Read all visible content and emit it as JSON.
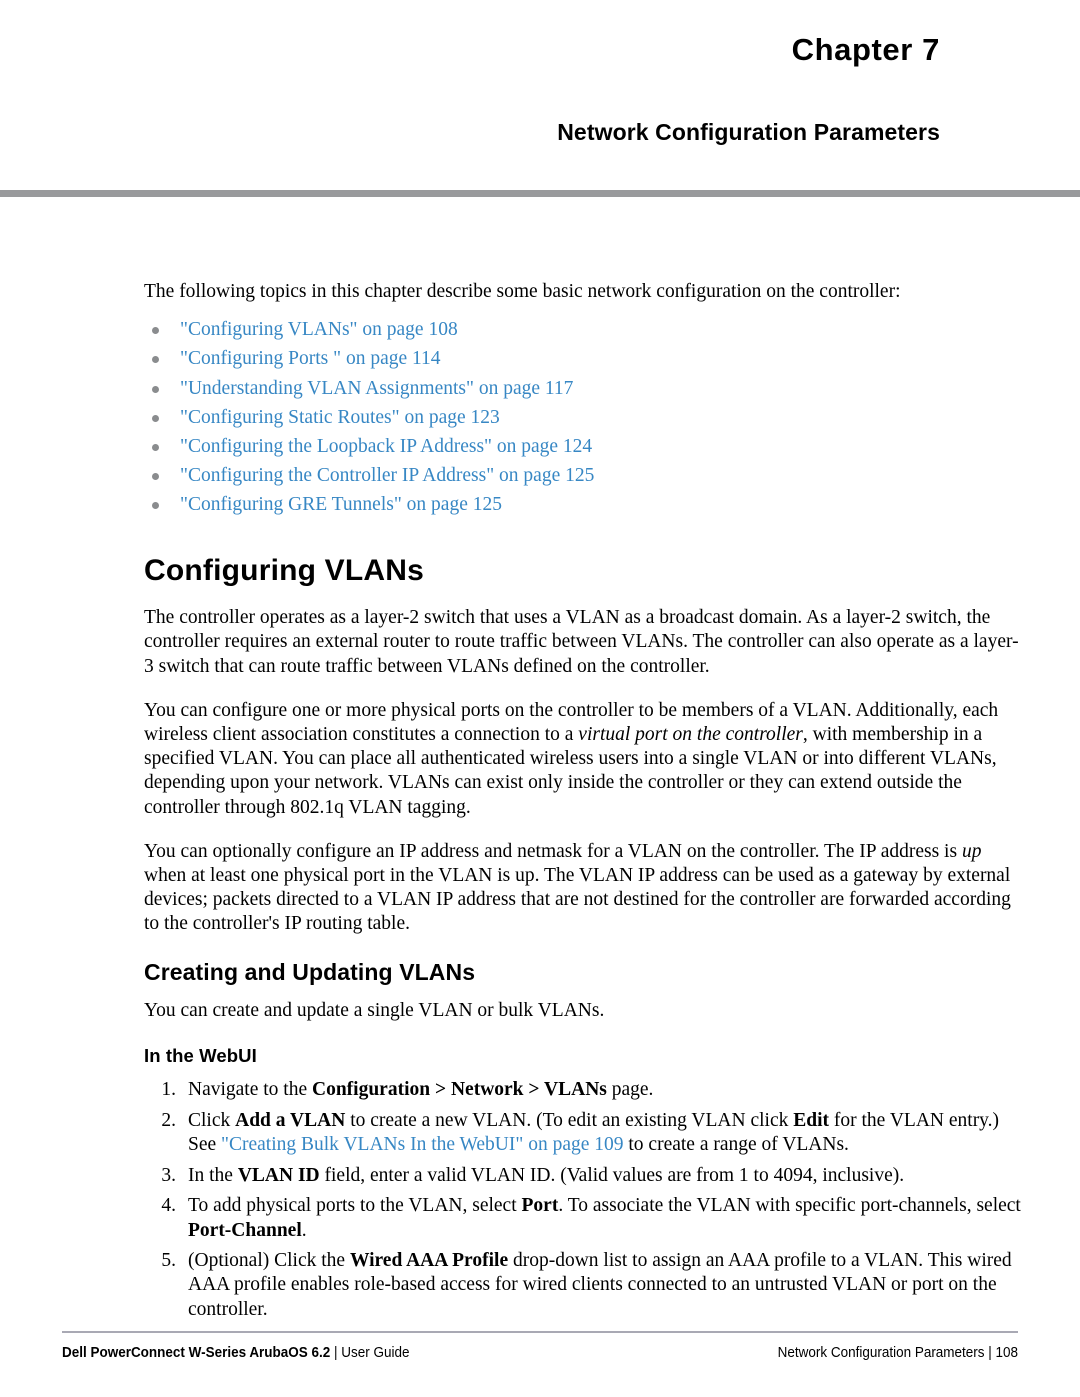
{
  "header": {
    "chapter_number": "Chapter 7",
    "chapter_title": "Network Configuration Parameters",
    "rule_color": "#999a9c"
  },
  "colors": {
    "link": "#3787c4",
    "bullet": "#8a8c8e",
    "header_rule": "#999a9c",
    "footer_rule": "#a9a9b4",
    "text": "#000000"
  },
  "intro": {
    "text": "The following topics in this chapter describe some basic network configuration on the controller:"
  },
  "topics": [
    {
      "label": "\"Configuring VLANs\" on page 108"
    },
    {
      "label": "\"Configuring Ports \" on page 114"
    },
    {
      "label": "\"Understanding VLAN Assignments\" on page 117"
    },
    {
      "label": "\"Configuring Static Routes\" on page 123"
    },
    {
      "label": "\"Configuring the Loopback IP Address\" on page 124"
    },
    {
      "label": "\"Configuring the Controller IP Address\" on page 125"
    },
    {
      "label": "\"Configuring GRE Tunnels\" on page 125"
    }
  ],
  "sections": {
    "configuring_vlans": {
      "heading": "Configuring VLANs",
      "para1": "The controller operates as a layer-2 switch that uses a VLAN as a broadcast domain. As a layer-2 switch, the controller requires an external router to route traffic between VLANs. The controller can also operate as a layer-3 switch that can route traffic between VLANs defined on the controller.",
      "para2_a": "You can configure one or more physical ports on the controller to be members of a VLAN. Additionally, each wireless client association constitutes a connection to a ",
      "para2_italic": "virtual port on the controller",
      "para2_b": ", with membership in a specified VLAN. You can place all authenticated wireless users into a single VLAN or into different VLANs, depending upon your network. VLANs can exist only inside the controller or they can extend outside the controller through 802.1q VLAN tagging.",
      "para3_a": "You can optionally configure an IP address and netmask for a VLAN on the controller. The IP address is ",
      "para3_italic": "up",
      "para3_b": " when at least one physical port in the VLAN is up. The VLAN IP address can be used as a gateway by external devices; packets directed to a VLAN IP address that are not destined for the controller are forwarded according to the controller's IP routing table."
    },
    "creating_updating": {
      "heading": "Creating and Updating VLANs",
      "para": "You can create and update a single VLAN or bulk VLANs.",
      "subheading": "In the WebUI"
    }
  },
  "steps": [
    {
      "num": "1.",
      "parts": [
        {
          "t": "Navigate to the ",
          "style": "normal"
        },
        {
          "t": "Configuration > Network > VLANs",
          "style": "bold"
        },
        {
          "t": " page.",
          "style": "normal"
        }
      ]
    },
    {
      "num": "2.",
      "parts": [
        {
          "t": "Click ",
          "style": "normal"
        },
        {
          "t": "Add a VLAN",
          "style": "bold"
        },
        {
          "t": " to create a new VLAN. (To edit an existing VLAN click ",
          "style": "normal"
        },
        {
          "t": "Edit",
          "style": "bold"
        },
        {
          "t": " for the VLAN entry.) See ",
          "style": "normal"
        },
        {
          "t": "\"Creating Bulk VLANs In the WebUI\" on page 109",
          "style": "link"
        },
        {
          "t": " to create a range of VLANs.",
          "style": "normal"
        }
      ]
    },
    {
      "num": "3.",
      "parts": [
        {
          "t": "In the ",
          "style": "normal"
        },
        {
          "t": "VLAN ID",
          "style": "bold"
        },
        {
          "t": " field, enter a valid VLAN ID. (Valid values are from 1 to 4094, inclusive).",
          "style": "normal"
        }
      ]
    },
    {
      "num": "4.",
      "parts": [
        {
          "t": "To add physical ports to the VLAN, select ",
          "style": "normal"
        },
        {
          "t": "Port",
          "style": "bold"
        },
        {
          "t": ". To associate the VLAN with specific port-channels, select ",
          "style": "normal"
        },
        {
          "t": "Port-Channel",
          "style": "bold"
        },
        {
          "t": ".",
          "style": "normal"
        }
      ]
    },
    {
      "num": "5.",
      "parts": [
        {
          "t": "(Optional) Click the ",
          "style": "normal"
        },
        {
          "t": "Wired AAA Profile",
          "style": "bold"
        },
        {
          "t": " drop-down list to assign an AAA profile to a VLAN. This wired AAA profile enables role-based access for wired clients connected to an untrusted VLAN or port on the controller.",
          "style": "normal"
        }
      ]
    }
  ],
  "footer": {
    "left_bold": "Dell PowerConnect W-Series ArubaOS 6.2",
    "left_sep": " | ",
    "left_rest": "User Guide",
    "right_title": "Network Configuration Parameters",
    "right_sep": " | ",
    "right_page": "108"
  }
}
